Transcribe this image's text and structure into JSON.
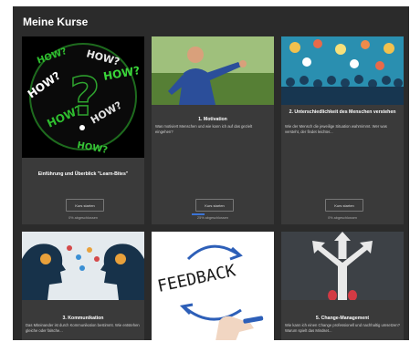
{
  "page": {
    "title": "Meine Kurse"
  },
  "colors": {
    "background": "#2b2b2b",
    "card": "#3a3a3a",
    "progress": "#3b74d6"
  },
  "courses": [
    {
      "image": "how-question-mark-word-cloud-image",
      "title": "Einführung und Überblick \"Learn-Bites\"",
      "description": "",
      "button_label": "Kurs starten",
      "completion": "0% abgeschlossen",
      "progress": 0
    },
    {
      "image": "man-throwing-golf-image",
      "title": "1. Motivation",
      "description": "Was motiviert Menschen und wie kann ich auf das gezielt eingehen?",
      "button_label": "Kurs starten",
      "completion": "25% abgeschlossen",
      "progress": 25
    },
    {
      "image": "crowd-with-speech-bubbles-image",
      "title": "2. Unterschiedlichkeit des Menschen verstehen",
      "description": "Wie der Mensch die jeweilige Situation wahrnimmt. Wer was versteht, der findet leichter...",
      "button_label": "Kurs starten",
      "completion": "0% abgeschlossen",
      "progress": 0
    },
    {
      "image": "two-heads-gears-communication-image",
      "title": "3. Kommunikation",
      "description": "Das Miteinander ist durch Kommunikation bestimmt. Wie entstehen gleiche oder falsche...",
      "button_label": "",
      "completion": "",
      "progress": 0
    },
    {
      "image": "feedback-handwritten-image",
      "title": "",
      "description": "",
      "button_label": "",
      "completion": "",
      "progress": 0
    },
    {
      "image": "crossroads-arrows-shoes-image",
      "title": "5. Change-Management",
      "description": "Wie kann ich einen Change professionell und nachhaltig umsetzen? Warum spielt das Mindset...",
      "button_label": "",
      "completion": "",
      "progress": 0
    }
  ],
  "image_texts": {
    "how_word": "HOW?",
    "feedback_word": "FEEDBACK"
  }
}
